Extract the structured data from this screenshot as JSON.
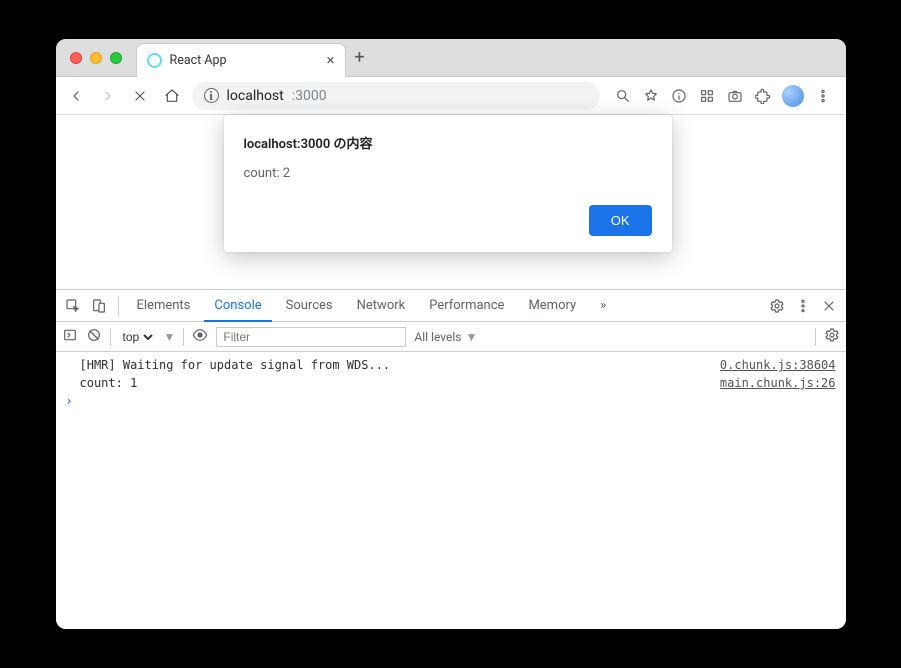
{
  "tab": {
    "title": "React App"
  },
  "address": {
    "host": "localhost",
    "port": ":3000"
  },
  "dialog": {
    "title": "localhost:3000 の内容",
    "message": "count: 2",
    "ok": "OK"
  },
  "devtools": {
    "tabs": [
      "Elements",
      "Console",
      "Sources",
      "Network",
      "Performance",
      "Memory"
    ],
    "active": "Console",
    "more": "»",
    "toolbar": {
      "context": "top",
      "filter_placeholder": "Filter",
      "levels": "All levels"
    },
    "logs": [
      {
        "msg": "[HMR] Waiting for update signal from WDS...",
        "src": "0.chunk.js:38604"
      },
      {
        "msg": "count: 1",
        "src": "main.chunk.js:26"
      }
    ]
  }
}
